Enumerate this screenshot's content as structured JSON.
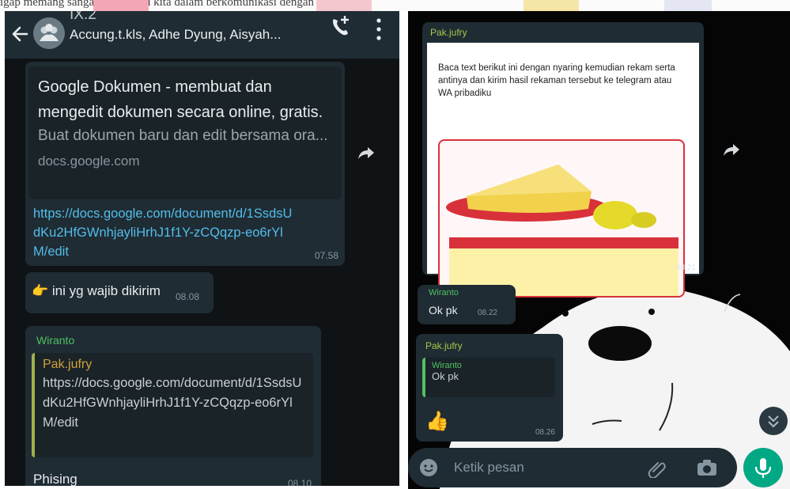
{
  "caption_fragment": "igap memang sangat membantu kita dalam berkomunikasi dengan aplikasi",
  "left_chat": {
    "header": {
      "group_name": "IX.2",
      "members": "Accung.t.kls, Adhe Dyung, Aisyah..."
    },
    "messages": [
      {
        "preview_title": "Google Dokumen - membuat dan mengedit dokumen secara online, gratis.",
        "preview_description": "Buat dokumen baru dan edit bersama ora...",
        "preview_domain": "docs.google.com",
        "link": "https://docs.google.com/document/d/1SsdsUdKu2HfGWnhjayliHrhJ1f1Y-zCQqzp-eo6rYlM/edit",
        "time": "07.58"
      },
      {
        "emoji": "👉",
        "text": "ini yg wajib dikirim",
        "time": "08.08"
      },
      {
        "sender": "Wiranto",
        "quoted_name": "Pak.jufry",
        "quoted_text": "https://docs.google.com/document/d/1SsdsUdKu2HfGWnhjayliHrhJ1f1Y-zCQqzp-eo6rYlM/edit",
        "text": "Phising",
        "time": "08.10"
      }
    ]
  },
  "right_chat": {
    "image_message": {
      "sender": "Pak.jufry",
      "document_text": "Baca text berikut ini dengan nyaring kemudian rekam serta antinya dan kirim hasil rekaman tersebut ke telegram atau WA pribadiku",
      "time": "08.21"
    },
    "okpk_message": {
      "sender": "Wiranto",
      "text": "Ok pk",
      "time": "08.22"
    },
    "reply_message": {
      "sender": "Pak.jufry",
      "quoted_name": "Wiranto",
      "quoted_text": "Ok pk",
      "emoji": "👍",
      "time": "08.26"
    },
    "input": {
      "placeholder": "Ketik pesan"
    }
  },
  "colors": {
    "chat_background": "#0f1316",
    "bubble": "#1f2c33",
    "link": "#53bdeb",
    "sender_green": "#4fc164",
    "mic_button": "#00a884"
  }
}
